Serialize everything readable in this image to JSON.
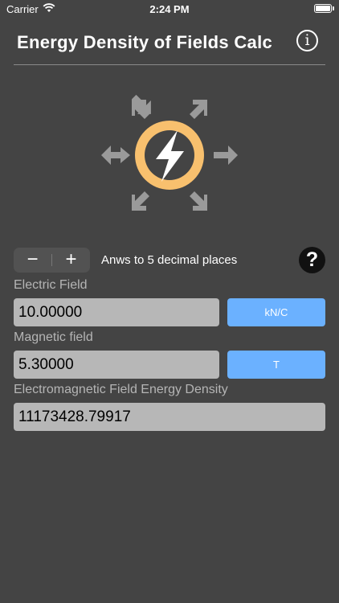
{
  "status_bar": {
    "carrier": "Carrier",
    "time": "2:24 PM"
  },
  "header": {
    "title": "Energy Density of Fields Calc",
    "info_icon": "i"
  },
  "logo": {
    "icon": "lightning-bolt-icon",
    "ring_color": "#f8c06e",
    "arrow_color": "#9a9a9a"
  },
  "precision": {
    "minus": "−",
    "plus": "+",
    "label": "Anws to 5 decimal places",
    "help": "?"
  },
  "electric": {
    "label": "Electric Field",
    "value": "10.00000",
    "unit": "kN/C"
  },
  "magnetic": {
    "label": "Magnetic field",
    "value": "5.30000",
    "unit": "T"
  },
  "result": {
    "label": "Electromagnetic Field Energy Density",
    "value": "11173428.79917"
  },
  "colors": {
    "background": "#444444",
    "accent": "#6bb1ff",
    "input": "#b7b7b7"
  }
}
